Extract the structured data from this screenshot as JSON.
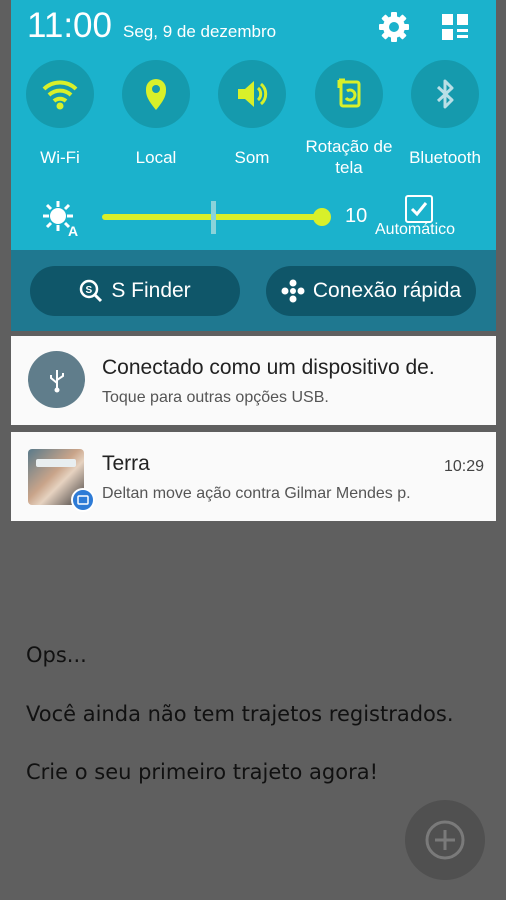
{
  "status_bar": {
    "time": "11:00",
    "date": "Seg, 9 de dezembro"
  },
  "quick_settings": {
    "toggles": [
      {
        "label": "Wi-Fi",
        "icon": "wifi-icon"
      },
      {
        "label": "Local",
        "icon": "location-icon"
      },
      {
        "label": "Som",
        "icon": "volume-icon"
      },
      {
        "label": "Rotação de tela",
        "icon": "rotation-icon"
      },
      {
        "label": "Bluetooth",
        "icon": "bluetooth-icon"
      }
    ],
    "brightness": {
      "value": "10",
      "level": 0.95,
      "auto_label": "Automático",
      "auto_checked": true
    }
  },
  "shortcuts": {
    "s_finder": "S Finder",
    "quick_connect": "Conexão rápida"
  },
  "notifications": [
    {
      "title": "Conectado como um dispositivo de.",
      "subtitle": "Toque para outras opções USB.",
      "icon": "usb-icon"
    },
    {
      "title": "Terra",
      "time": "10:29",
      "subtitle": "Deltan move ação contra Gilmar Mendes p.",
      "icon": "avatar"
    }
  ],
  "background_app": {
    "line1": "Ops...",
    "line2": "Você ainda não tem trajetos registrados.",
    "line3": "Crie o seu primeiro trajeto agora!"
  },
  "colors": {
    "accent": "#1bb2cc",
    "shade_dark": "#1f7890",
    "slider": "#d8f02a",
    "icon_active": "#d8f02a"
  }
}
